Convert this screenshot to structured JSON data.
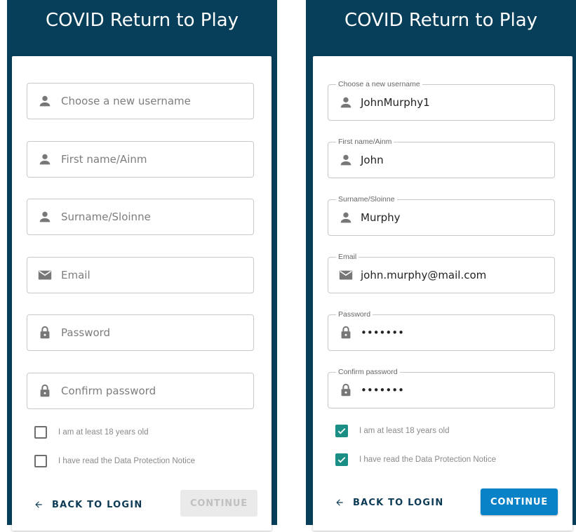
{
  "title": "COVID Return to Play",
  "colors": {
    "header": "#073f5a",
    "accent": "#0a82c8",
    "checked": "#1b8f86"
  },
  "left_form": {
    "username": {
      "placeholder": "Choose a new username",
      "icon": "person-icon"
    },
    "first_name": {
      "placeholder": "First name/Ainm",
      "icon": "person-icon"
    },
    "surname": {
      "placeholder": "Surname/Sloinne",
      "icon": "person-icon"
    },
    "email": {
      "placeholder": "Email",
      "icon": "mail-icon"
    },
    "password": {
      "placeholder": "Password",
      "icon": "lock-icon"
    },
    "confirm_password": {
      "placeholder": "Confirm password",
      "icon": "lock-icon"
    },
    "age_check": {
      "label": "I am at least 18 years old",
      "checked": false
    },
    "dpn_check": {
      "label": "I have read the Data Protection Notice",
      "checked": false
    },
    "back_label": "BACK TO LOGIN",
    "continue_label": "CONTINUE"
  },
  "right_form": {
    "username": {
      "label": "Choose a new username",
      "value": "JohnMurphy1",
      "icon": "person-icon"
    },
    "first_name": {
      "label": "First name/Ainm",
      "value": "John",
      "icon": "person-icon"
    },
    "surname": {
      "label": "Surname/Sloinne",
      "value": "Murphy",
      "icon": "person-icon"
    },
    "email": {
      "label": "Email",
      "value": "john.murphy@mail.com",
      "icon": "mail-icon"
    },
    "password": {
      "label": "Password",
      "value": "•••••••",
      "icon": "lock-icon"
    },
    "confirm_password": {
      "label": "Confirm password",
      "value": "•••••••",
      "icon": "lock-icon"
    },
    "age_check": {
      "label": "I am at least 18 years old",
      "checked": true
    },
    "dpn_check": {
      "label": "I have read the Data Protection Notice",
      "checked": true
    },
    "back_label": "BACK TO LOGIN",
    "continue_label": "CONTINUE"
  }
}
